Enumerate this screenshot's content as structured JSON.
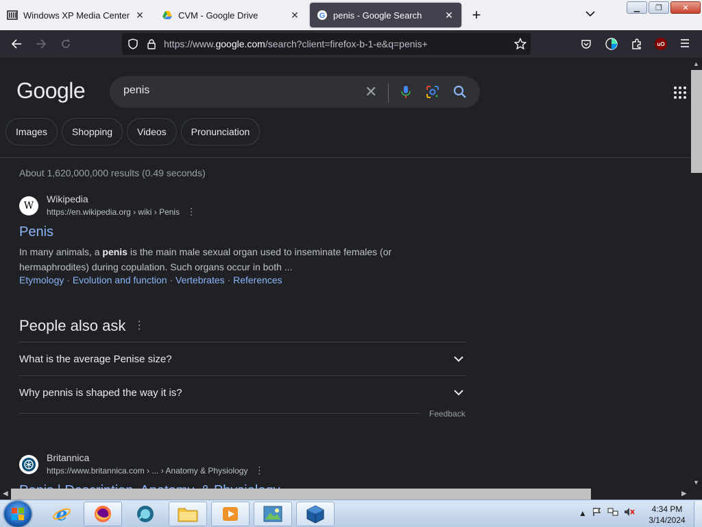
{
  "browser": {
    "tabs": [
      {
        "title": "Windows XP Media Center Editi",
        "icon": "archive-icon",
        "active": false
      },
      {
        "title": "CVM - Google Drive",
        "icon": "google-drive-icon",
        "active": false
      },
      {
        "title": "penis - Google Search",
        "icon": "google-g-icon",
        "active": true
      }
    ],
    "new_tab_label": "+",
    "url_prefix": "https://www.",
    "url_domain": "google.com",
    "url_suffix": "/search?client=firefox-b-1-e&q=penis+"
  },
  "search": {
    "logo": "Google",
    "query": "penis",
    "chips": [
      "Images",
      "Shopping",
      "Videos",
      "Pronunciation"
    ],
    "stats": "About 1,620,000,000 results (0.49 seconds)"
  },
  "results": [
    {
      "site_name": "Wikipedia",
      "site_icon_letter": "W",
      "url": "https://en.wikipedia.org › wiki › Penis",
      "title": "Penis",
      "snippet_before": "In many animals, a ",
      "snippet_bold": "penis",
      "snippet_after": " is the main male sexual organ used to inseminate females (or hermaphrodites) during copulation. Such organs occur in both ...",
      "sitelinks": [
        "Etymology",
        "Evolution and function",
        "Vertebrates",
        "References"
      ]
    },
    {
      "site_name": "Britannica",
      "url": "https://www.britannica.com › ... › Anatomy & Physiology",
      "title": "Penis | Description, Anatomy, & Physiology"
    }
  ],
  "people_also_ask": {
    "title": "People also ask",
    "questions": [
      "What is the average Penise size?",
      "Why pennis is shaped the way it is?"
    ],
    "feedback": "Feedback"
  },
  "taskbar": {
    "time": "4:34 PM",
    "date": "3/14/2024"
  },
  "colors": {
    "page_bg": "#202124",
    "link": "#8ab4f8",
    "text": "#e8eaed",
    "muted": "#9aa0a6"
  }
}
